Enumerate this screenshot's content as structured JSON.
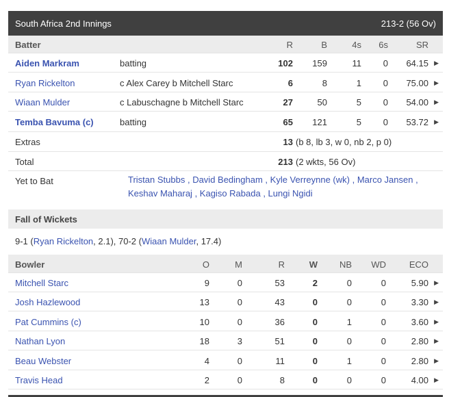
{
  "header": {
    "title": "South Africa 2nd Innings",
    "score": "213-2 (56 Ov)"
  },
  "batting": {
    "headers": {
      "batter": "Batter",
      "r": "R",
      "b": "B",
      "fours": "4s",
      "sixes": "6s",
      "sr": "SR"
    },
    "rows": [
      {
        "name": "Aiden Markram",
        "dismissal": "batting",
        "r": "102",
        "b": "159",
        "fours": "11",
        "sixes": "0",
        "sr": "64.15",
        "bold": true
      },
      {
        "name": "Ryan Rickelton",
        "dismissal": "c Alex Carey b Mitchell Starc",
        "r": "6",
        "b": "8",
        "fours": "1",
        "sixes": "0",
        "sr": "75.00",
        "bold": false
      },
      {
        "name": "Wiaan Mulder",
        "dismissal": "c Labuschagne b Mitchell Starc",
        "r": "27",
        "b": "50",
        "fours": "5",
        "sixes": "0",
        "sr": "54.00",
        "bold": false
      },
      {
        "name": "Temba Bavuma (c)",
        "dismissal": "batting",
        "r": "65",
        "b": "121",
        "fours": "5",
        "sixes": "0",
        "sr": "53.72",
        "bold": true
      }
    ],
    "extras": {
      "label": "Extras",
      "value": "13",
      "detail": "(b 8, lb 3, w 0, nb 2, p 0)"
    },
    "total": {
      "label": "Total",
      "value": "213",
      "detail": "(2 wkts, 56 Ov)"
    },
    "yet_to_bat": {
      "label": "Yet to Bat",
      "players": [
        "Tristan Stubbs",
        "David Bedingham",
        "Kyle Verreynne (wk)",
        "Marco Jansen",
        "Keshav Maharaj",
        "Kagiso Rabada",
        "Lungi Ngidi"
      ]
    }
  },
  "fall_of_wickets": {
    "title": "Fall of Wickets",
    "w1_score": "9-1 (",
    "w1_name": "Ryan Rickelton",
    "w1_over": ", 2.1), 70-2 (",
    "w2_name": "Wiaan Mulder",
    "w2_over": ", 17.4)"
  },
  "bowling": {
    "headers": {
      "bowler": "Bowler",
      "o": "O",
      "m": "M",
      "r": "R",
      "w": "W",
      "nb": "NB",
      "wd": "WD",
      "eco": "ECO"
    },
    "rows": [
      {
        "name": "Mitchell Starc",
        "o": "9",
        "m": "0",
        "r": "53",
        "w": "2",
        "nb": "0",
        "wd": "0",
        "eco": "5.90"
      },
      {
        "name": "Josh Hazlewood",
        "o": "13",
        "m": "0",
        "r": "43",
        "w": "0",
        "nb": "0",
        "wd": "0",
        "eco": "3.30"
      },
      {
        "name": "Pat Cummins (c)",
        "o": "10",
        "m": "0",
        "r": "36",
        "w": "0",
        "nb": "1",
        "wd": "0",
        "eco": "3.60"
      },
      {
        "name": "Nathan Lyon",
        "o": "18",
        "m": "3",
        "r": "51",
        "w": "0",
        "nb": "0",
        "wd": "0",
        "eco": "2.80"
      },
      {
        "name": "Beau Webster",
        "o": "4",
        "m": "0",
        "r": "11",
        "w": "0",
        "nb": "1",
        "wd": "0",
        "eco": "2.80"
      },
      {
        "name": "Travis Head",
        "o": "2",
        "m": "0",
        "r": "8",
        "w": "0",
        "nb": "0",
        "wd": "0",
        "eco": "4.00"
      }
    ]
  },
  "icons": {
    "row_expand": "triangle-right-icon"
  },
  "colors": {
    "header_bg": "#404040",
    "link": "#3a53b0",
    "subheader_bg": "#ececec"
  }
}
